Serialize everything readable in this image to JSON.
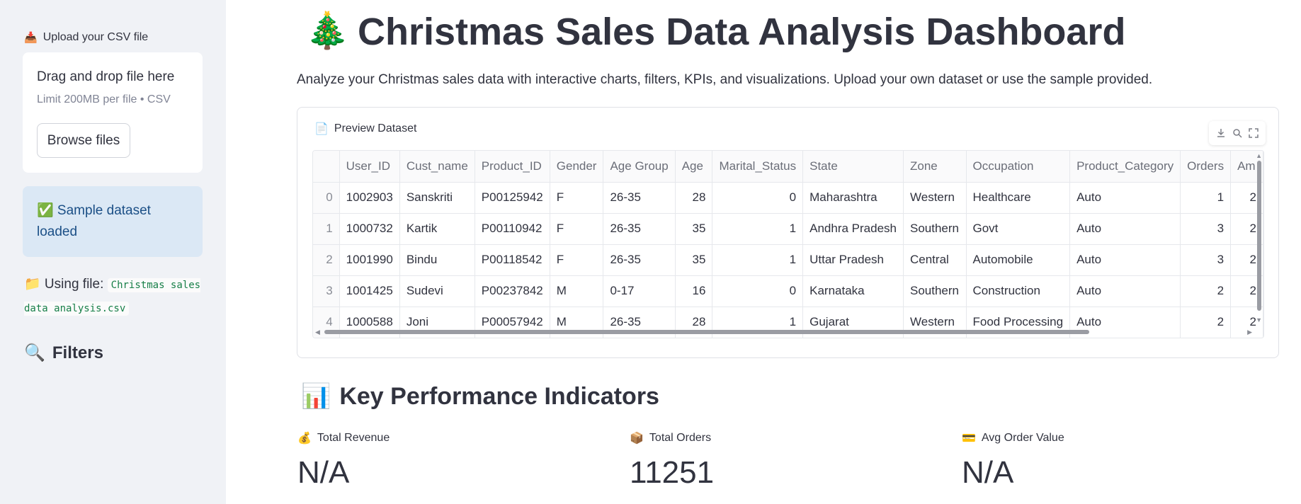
{
  "sidebar": {
    "upload_label": "Upload your CSV file",
    "upload_icon": "inbox-tray-icon",
    "dropzone_title": "Drag and drop file here",
    "dropzone_limit": "Limit 200MB per file • CSV",
    "browse_label": "Browse files",
    "success_text": "✅ Sample dataset loaded",
    "using_file_label": "📁 Using file:",
    "using_file_name": "Christmas sales data analysis.csv",
    "filters_title": "Filters"
  },
  "main": {
    "title_icon": "🎄",
    "title": "Christmas Sales Data Analysis Dashboard",
    "description": "Analyze your Christmas sales data with interactive charts, filters, KPIs, and visualizations. Upload your own dataset or use the sample provided.",
    "preview_label": "Preview Dataset",
    "kpi_title": "Key Performance Indicators"
  },
  "table": {
    "columns": [
      "",
      "User_ID",
      "Cust_name",
      "Product_ID",
      "Gender",
      "Age Group",
      "Age",
      "Marital_Status",
      "State",
      "Zone",
      "Occupation",
      "Product_Category",
      "Orders",
      "Am"
    ],
    "rows": [
      [
        "0",
        "1002903",
        "Sanskriti",
        "P00125942",
        "F",
        "26-35",
        "28",
        "0",
        "Maharashtra",
        "Western",
        "Healthcare",
        "Auto",
        "1",
        "2"
      ],
      [
        "1",
        "1000732",
        "Kartik",
        "P00110942",
        "F",
        "26-35",
        "35",
        "1",
        "Andhra Pradesh",
        "Southern",
        "Govt",
        "Auto",
        "3",
        "2"
      ],
      [
        "2",
        "1001990",
        "Bindu",
        "P00118542",
        "F",
        "26-35",
        "35",
        "1",
        "Uttar Pradesh",
        "Central",
        "Automobile",
        "Auto",
        "3",
        "2"
      ],
      [
        "3",
        "1001425",
        "Sudevi",
        "P00237842",
        "M",
        "0-17",
        "16",
        "0",
        "Karnataka",
        "Southern",
        "Construction",
        "Auto",
        "2",
        "2"
      ],
      [
        "4",
        "1000588",
        "Joni",
        "P00057942",
        "M",
        "26-35",
        "28",
        "1",
        "Gujarat",
        "Western",
        "Food Processing",
        "Auto",
        "2",
        "2"
      ]
    ]
  },
  "kpis": [
    {
      "icon": "💰",
      "label": "Total Revenue",
      "value": "N/A"
    },
    {
      "icon": "📦",
      "label": "Total Orders",
      "value": "11251"
    },
    {
      "icon": "💳",
      "label": "Avg Order Value",
      "value": "N/A"
    }
  ],
  "colors": {
    "sidebar_bg": "#f0f2f6",
    "success_bg": "#dbe8f5",
    "success_text": "#1b4f86",
    "code_text": "#177f48",
    "text": "#31333f"
  }
}
